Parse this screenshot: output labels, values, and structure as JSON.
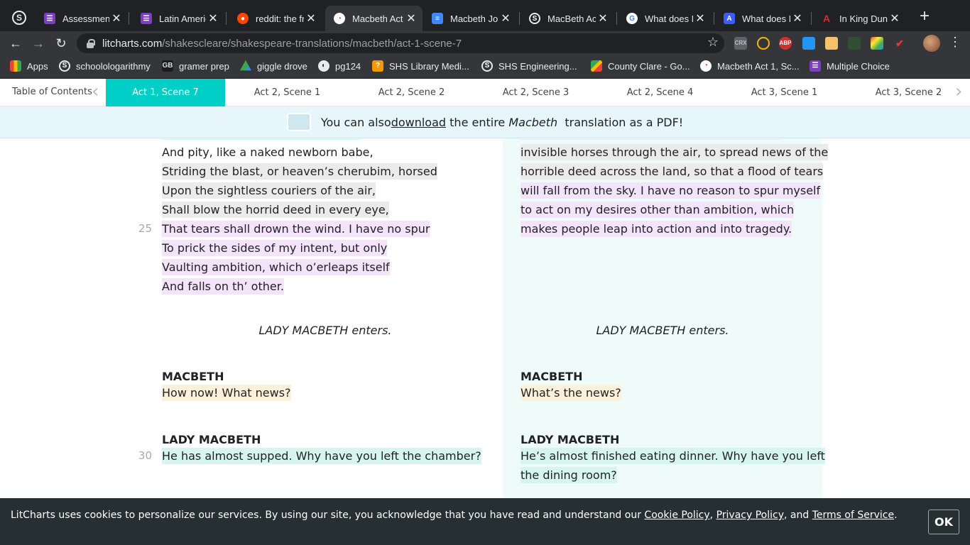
{
  "browser": {
    "tabs": [
      {
        "title": "Assessment",
        "icon": "form-icon",
        "color": "#7b3fbf"
      },
      {
        "title": "Latin Americ",
        "icon": "form-icon",
        "color": "#7b3fbf"
      },
      {
        "title": "reddit: the fr",
        "icon": "reddit-icon",
        "color": "#ff4500"
      },
      {
        "title": "Macbeth Act",
        "icon": "litcharts-icon",
        "color": "#ffffff"
      },
      {
        "title": "Macbeth Jou",
        "icon": "docs-icon",
        "color": "#4285f4"
      },
      {
        "title": "MacBeth Act",
        "icon": "schoology-icon",
        "color": "#202124"
      },
      {
        "title": "What does M",
        "icon": "google-icon",
        "color": "#ffffff"
      },
      {
        "title": "What does M",
        "icon": "translate-icon",
        "color": "#3d5afe"
      },
      {
        "title": "In King Dunc",
        "icon": "a-plus-icon",
        "color": "#d32f2f"
      }
    ],
    "url_host": "litcharts.com",
    "url_path": "/shakescleare/shakespeare-translations/macbeth/act-1-scene-7",
    "bookmarks": [
      {
        "label": "Apps",
        "icon": "apps-grid-icon"
      },
      {
        "label": "schoolologarithmy",
        "icon": "schoology-icon"
      },
      {
        "label": "gramer prep",
        "icon": "gb-icon"
      },
      {
        "label": "giggle drove",
        "icon": "drive-icon"
      },
      {
        "label": "pg124",
        "icon": "globe-icon"
      },
      {
        "label": "SHS Library Medi...",
        "icon": "library-icon"
      },
      {
        "label": "SHS Engineering...",
        "icon": "schoology-icon"
      },
      {
        "label": "County Clare - Go...",
        "icon": "maps-icon"
      },
      {
        "label": "Macbeth Act 1, Sc...",
        "icon": "litcharts-icon"
      },
      {
        "label": "Multiple Choice",
        "icon": "form-icon"
      }
    ],
    "extensions": [
      "CRX",
      "",
      "ABP",
      "",
      "",
      "",
      "",
      ""
    ]
  },
  "section_nav": {
    "toc_label": "Table of Contents",
    "sections": [
      "Act 1, Scene 7",
      "Act 2, Scene 1",
      "Act 2, Scene 2",
      "Act 2, Scene 3",
      "Act 2, Scene 4",
      "Act 3, Scene 1",
      "Act 3, Scene 2"
    ]
  },
  "banner": {
    "prefix": "You can also ",
    "link": "download",
    "middle": " the entire ",
    "title": "Macbeth",
    "suffix": "  translation as a PDF!"
  },
  "original": {
    "lines": [
      "And pity, like a naked newborn babe,",
      "Striding the blast, or heaven’s cherubim, horsed",
      "Upon the sightless couriers of the air,",
      "Shall blow the horrid deed in every eye,",
      "That tears shall drown the wind. I have no spur",
      "To prick the sides of my intent, but only",
      "Vaulting ambition, which o’erleaps itself",
      "And falls on th’ other."
    ],
    "line_number_25": "25",
    "stage": "LADY MACBETH enters.",
    "speaker1": "MACBETH",
    "speech1": "How now! What news?",
    "speaker2": "LADY MACBETH",
    "line_number_30": "30",
    "speech2": "He has almost supped. Why have you left the chamber?"
  },
  "modern": {
    "lines": [
      "invisible horses through the air, to spread news of the",
      "horrible deed across the land, so that a flood of tears",
      "will fall from the sky. I have no reason to spur myself",
      "to act on my desires other than ambition, which",
      "makes people leap into action and into tragedy."
    ],
    "stage": "LADY MACBETH enters.",
    "speaker1": "MACBETH",
    "speech1": "What’s the news?",
    "speaker2": "LADY MACBETH",
    "speech2_line1": "He’s almost finished eating dinner. Why have you left",
    "speech2_line2": "the dining room?"
  },
  "cookie": {
    "text": "LitCharts uses cookies to personalize our services. By using our site, you acknowledge that you have read and understand our ",
    "cookie_policy": "Cookie Policy",
    "sep1": ", ",
    "privacy_policy": "Privacy Policy",
    "sep2": ", and ",
    "terms": "Terms of Service",
    "end": ".",
    "ok": "OK"
  }
}
